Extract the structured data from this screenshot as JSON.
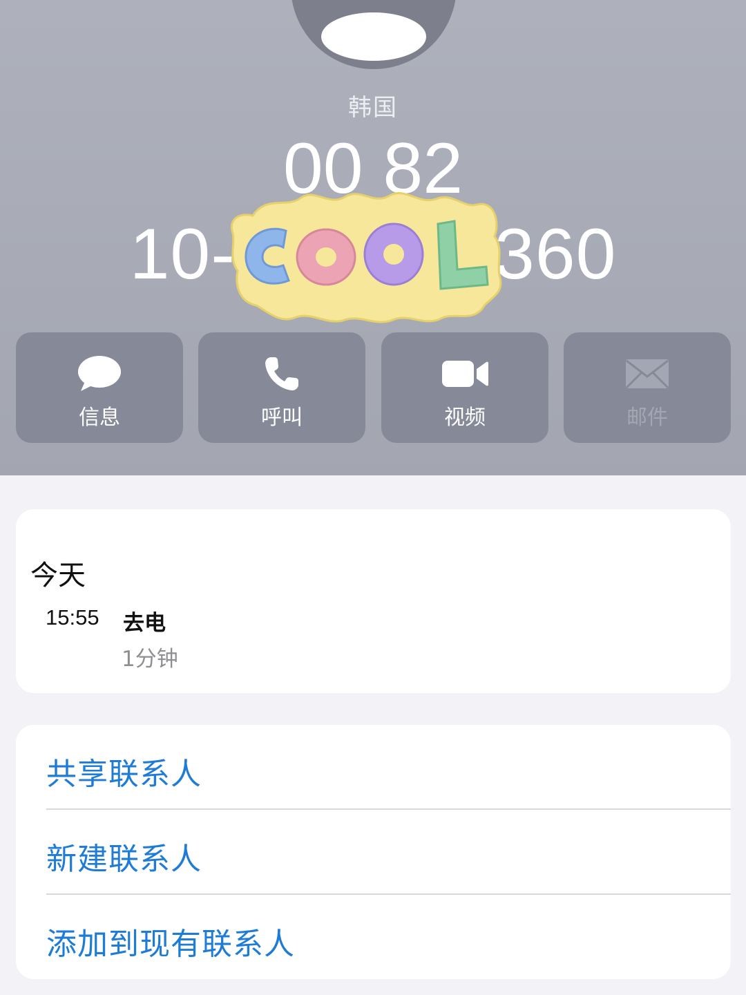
{
  "contact": {
    "location": "韩国",
    "number_line1": "00 82",
    "number_line2": "10-",
    "number_line2_end": "360",
    "sticker_text": "COOL"
  },
  "actions": [
    {
      "label": "信息",
      "icon": "message-bubble-icon",
      "enabled": true
    },
    {
      "label": "呼叫",
      "icon": "phone-icon",
      "enabled": true
    },
    {
      "label": "视频",
      "icon": "video-camera-icon",
      "enabled": true
    },
    {
      "label": "邮件",
      "icon": "envelope-icon",
      "enabled": false
    }
  ],
  "history": {
    "day": "今天",
    "entries": [
      {
        "time": "15:55",
        "type": "去电",
        "duration": "1分钟"
      }
    ]
  },
  "links": [
    {
      "label": "共享联系人"
    },
    {
      "label": "新建联系人"
    },
    {
      "label": "添加到现有联系人"
    }
  ],
  "colors": {
    "header_bg": "#a9acb6",
    "action_bg": "#868a98",
    "link_blue": "#1e7bd6",
    "page_bg": "#f2f2f7",
    "sticker_yellow": "#f6e79a",
    "sticker_c1": "#8fb6ea",
    "sticker_o1": "#eca3b3",
    "sticker_o2": "#b79ae8",
    "sticker_l": "#8fd0a6"
  }
}
